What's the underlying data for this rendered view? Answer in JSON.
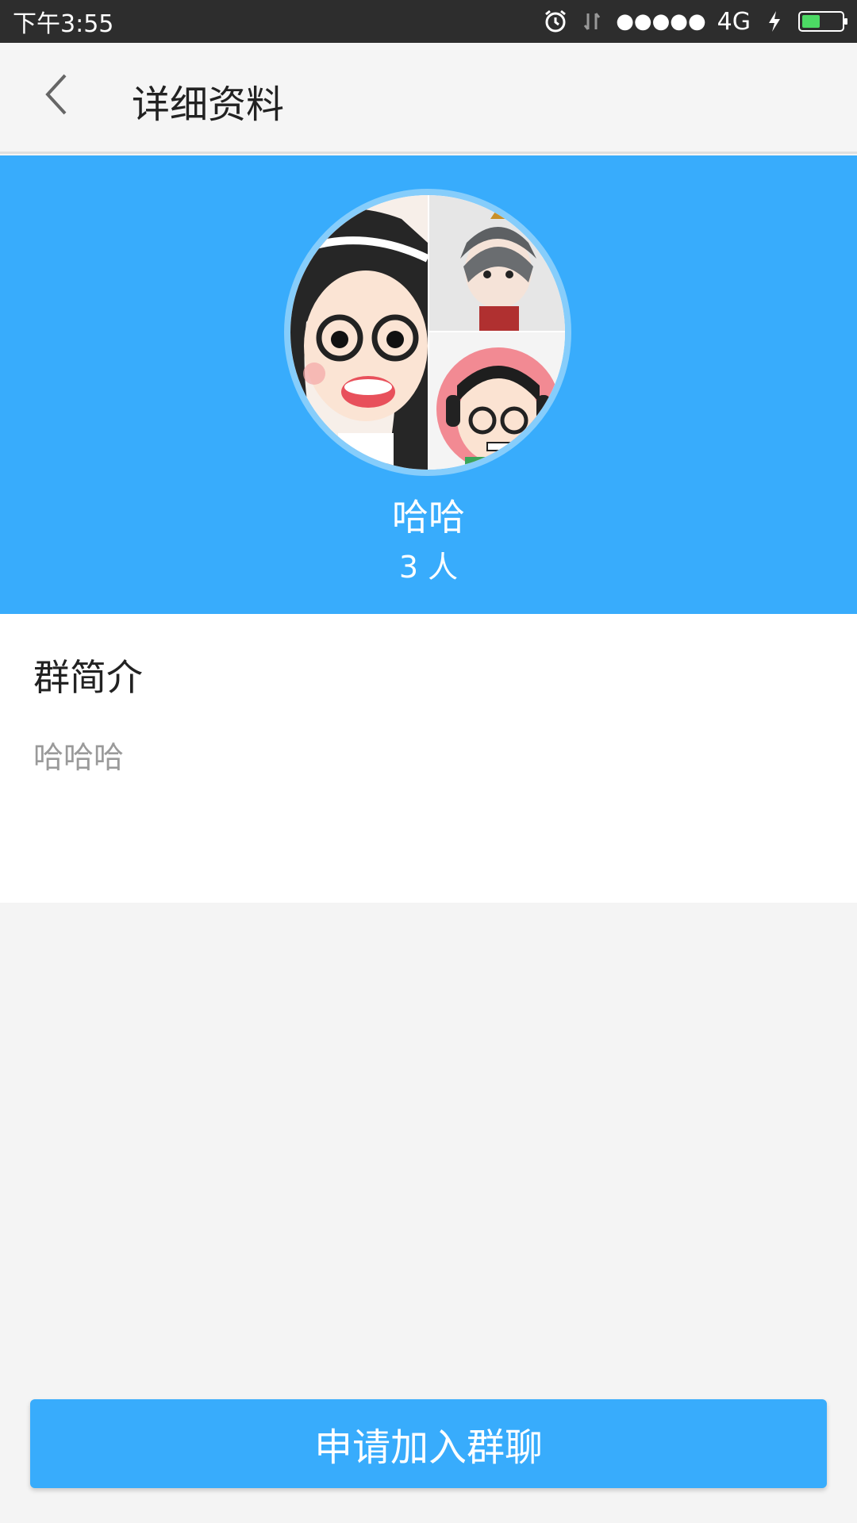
{
  "statusbar": {
    "time": "下午3:55",
    "network": "4G",
    "signal": "●●●●●",
    "icons": [
      "alarm-icon",
      "data-arrows-icon",
      "charging-icon",
      "battery-icon"
    ]
  },
  "header": {
    "back_icon": "chevron-left-icon",
    "title": "详细资料"
  },
  "group": {
    "name": "哈哈",
    "member_count": "3 人",
    "avatar": "group-avatar-collage"
  },
  "intro": {
    "title": "群简介",
    "text": "哈哈哈"
  },
  "actions": {
    "join_label": "申请加入群聊"
  },
  "colors": {
    "accent": "#38acfc",
    "statusbar": "#2d2d2d",
    "background": "#f4f4f4"
  }
}
